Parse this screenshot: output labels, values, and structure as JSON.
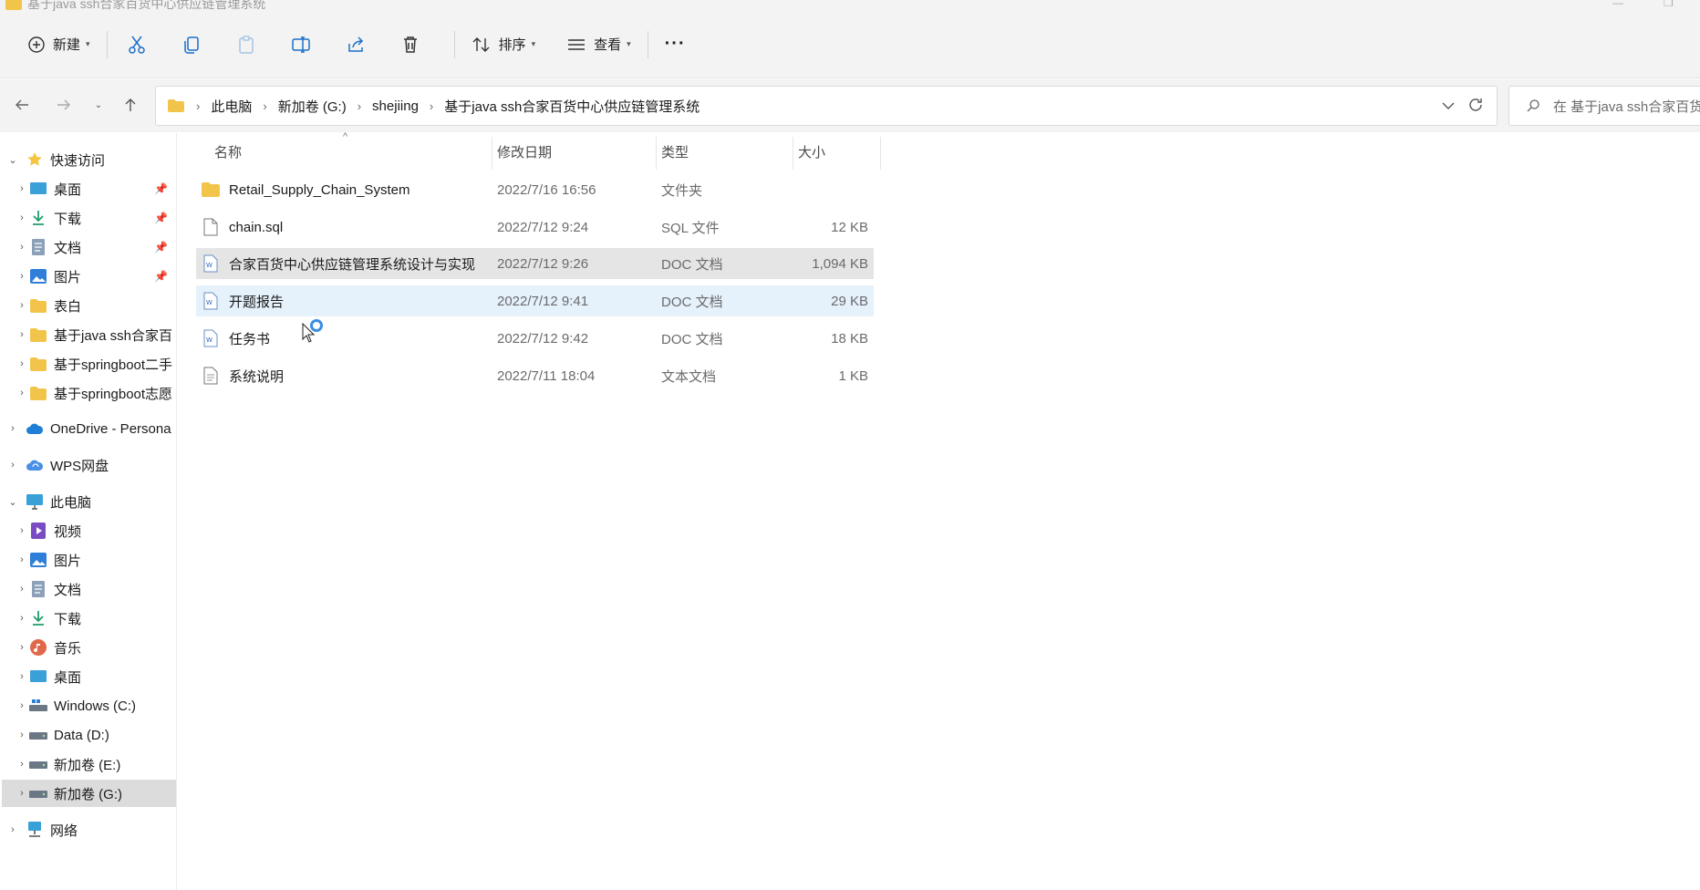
{
  "window": {
    "title": "基于java ssh合家百货中心供应链管理系统"
  },
  "toolbar": {
    "new_label": "新建",
    "sort_label": "排序",
    "view_label": "查看",
    "more_label": "···"
  },
  "address": {
    "crumbs": [
      "此电脑",
      "新加卷 (G:)",
      "shejiing",
      "基于java ssh合家百货中心供应链管理系统"
    ]
  },
  "search": {
    "placeholder": "在 基于java ssh合家百货"
  },
  "sidebar": {
    "quick_access": "快速访问",
    "quick_items": [
      {
        "label": "桌面",
        "icon": "desktop-icon",
        "pinned": true
      },
      {
        "label": "下载",
        "icon": "download-icon",
        "pinned": true
      },
      {
        "label": "文档",
        "icon": "documents-icon",
        "pinned": true
      },
      {
        "label": "图片",
        "icon": "pictures-icon",
        "pinned": true
      },
      {
        "label": "表白",
        "icon": "folder-icon",
        "pinned": false
      },
      {
        "label": "基于java ssh合家百",
        "icon": "folder-icon",
        "pinned": false
      },
      {
        "label": "基于springboot二手",
        "icon": "folder-icon",
        "pinned": false
      },
      {
        "label": "基于springboot志愿",
        "icon": "folder-icon",
        "pinned": false
      }
    ],
    "onedrive": "OneDrive - Persona",
    "wps": "WPS网盘",
    "this_pc": "此电脑",
    "pc_items": [
      {
        "label": "视频",
        "icon": "videos-icon"
      },
      {
        "label": "图片",
        "icon": "pictures-icon"
      },
      {
        "label": "文档",
        "icon": "documents-icon"
      },
      {
        "label": "下载",
        "icon": "download-icon"
      },
      {
        "label": "音乐",
        "icon": "music-icon"
      },
      {
        "label": "桌面",
        "icon": "desktop-icon"
      },
      {
        "label": "Windows (C:)",
        "icon": "drive-icon"
      },
      {
        "label": "Data (D:)",
        "icon": "drive-icon"
      },
      {
        "label": "新加卷 (E:)",
        "icon": "drive-icon"
      },
      {
        "label": "新加卷 (G:)",
        "icon": "drive-icon"
      }
    ],
    "network": "网络"
  },
  "columns": {
    "name": "名称",
    "date": "修改日期",
    "type": "类型",
    "size": "大小"
  },
  "files": [
    {
      "name": "Retail_Supply_Chain_System",
      "date": "2022/7/16 16:56",
      "type": "文件夹",
      "size": "",
      "icon": "folder-icon"
    },
    {
      "name": "chain.sql",
      "date": "2022/7/12 9:24",
      "type": "SQL 文件",
      "size": "12 KB",
      "icon": "file-icon"
    },
    {
      "name": "合家百货中心供应链管理系统设计与实现",
      "date": "2022/7/12 9:26",
      "type": "DOC 文档",
      "size": "1,094 KB",
      "icon": "doc-icon"
    },
    {
      "name": "开题报告",
      "date": "2022/7/12 9:41",
      "type": "DOC 文档",
      "size": "29 KB",
      "icon": "doc-icon"
    },
    {
      "name": "任务书",
      "date": "2022/7/12 9:42",
      "type": "DOC 文档",
      "size": "18 KB",
      "icon": "doc-icon"
    },
    {
      "name": "系统说明",
      "date": "2022/7/11 18:04",
      "type": "文本文档",
      "size": "1 KB",
      "icon": "text-file-icon"
    }
  ],
  "colors": {
    "folder": "#f2c54a",
    "hover_row": "#e5e5e5",
    "selected_row": "#e5f1fb",
    "accent": "#3a8ee6"
  }
}
